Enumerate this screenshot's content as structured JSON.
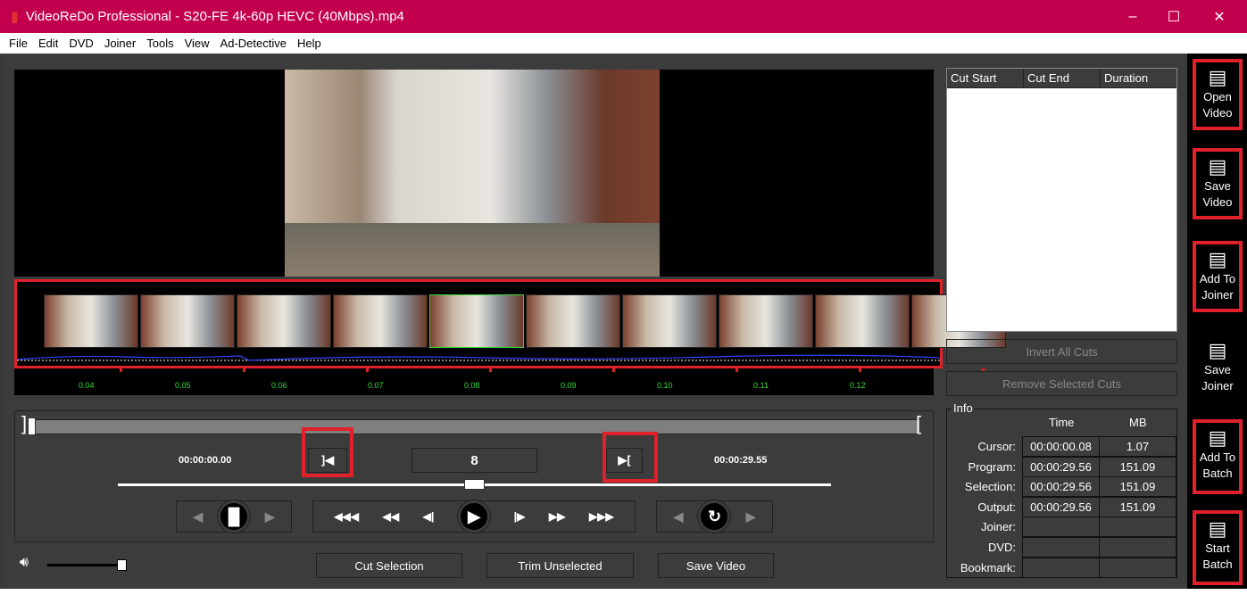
{
  "window": {
    "title": "VideoReDo Professional - S20-FE 4k-60p HEVC (40Mbps).mp4",
    "minimize": "–",
    "maximize": "☐",
    "close": "✕"
  },
  "menu": [
    "File",
    "Edit",
    "DVD",
    "Joiner",
    "Tools",
    "View",
    "Ad-Detective",
    "Help"
  ],
  "timeline": {
    "ticks": [
      "0.04",
      "0.05",
      "0.06",
      "0.07",
      "0.08",
      "0.09",
      "0.10",
      "0.11",
      "0.12"
    ],
    "selected_thumb": 4
  },
  "controls": {
    "start_time": "00:00:00.00",
    "end_time": "00:00:29.55",
    "frame": "8",
    "set_start": "]◀",
    "set_end": "▶[",
    "volume_level": 1.0,
    "seek_position": 0.0,
    "jog_position": 0.5
  },
  "transport": {
    "left_group": [
      "◀",
      "▐▌",
      "▶"
    ],
    "main": [
      "◀◀◀",
      "◀◀",
      "◀|",
      "▶",
      "|▶",
      "▶▶",
      "▶▶▶"
    ],
    "right_group": [
      "◀",
      "↻",
      "▶"
    ]
  },
  "buttons": {
    "cut_selection": "Cut Selection",
    "trim_unselected": "Trim Unselected",
    "save_video": "Save Video"
  },
  "cuts": {
    "headers": [
      "Cut Start",
      "Cut End",
      "Duration"
    ],
    "rows": [],
    "invert": "Invert All Cuts",
    "remove": "Remove Selected Cuts"
  },
  "info": {
    "title": "Info",
    "col_time": "Time",
    "col_mb": "MB",
    "rows": [
      {
        "label": "Cursor:",
        "time": "00:00:00.08",
        "mb": "1.07"
      },
      {
        "label": "Program:",
        "time": "00:00:29.56",
        "mb": "151.09"
      },
      {
        "label": "Selection:",
        "time": "00:00:29.56",
        "mb": "151.09"
      },
      {
        "label": "Output:",
        "time": "00:00:29.56",
        "mb": "151.09"
      },
      {
        "label": "Joiner:",
        "time": "",
        "mb": ""
      },
      {
        "label": "DVD:",
        "time": "",
        "mb": ""
      },
      {
        "label": "Bookmark:",
        "time": "",
        "mb": ""
      }
    ]
  },
  "sidebar": [
    {
      "l1": "Open",
      "l2": "Video",
      "icon": "open-video-icon"
    },
    {
      "l1": "Save",
      "l2": "Video",
      "icon": "save-video-icon"
    },
    {
      "l1": "Add To",
      "l2": "Joiner",
      "icon": "add-joiner-icon"
    },
    {
      "l1": "Save",
      "l2": "Joiner",
      "icon": "save-joiner-icon"
    },
    {
      "l1": "Add To",
      "l2": "Batch",
      "icon": "add-batch-icon"
    },
    {
      "l1": "Start",
      "l2": "Batch",
      "icon": "start-batch-icon"
    }
  ],
  "colors": {
    "titlebar": "#c3004d",
    "highlight": "#e0202a",
    "ruler_text": "#33dd33"
  }
}
